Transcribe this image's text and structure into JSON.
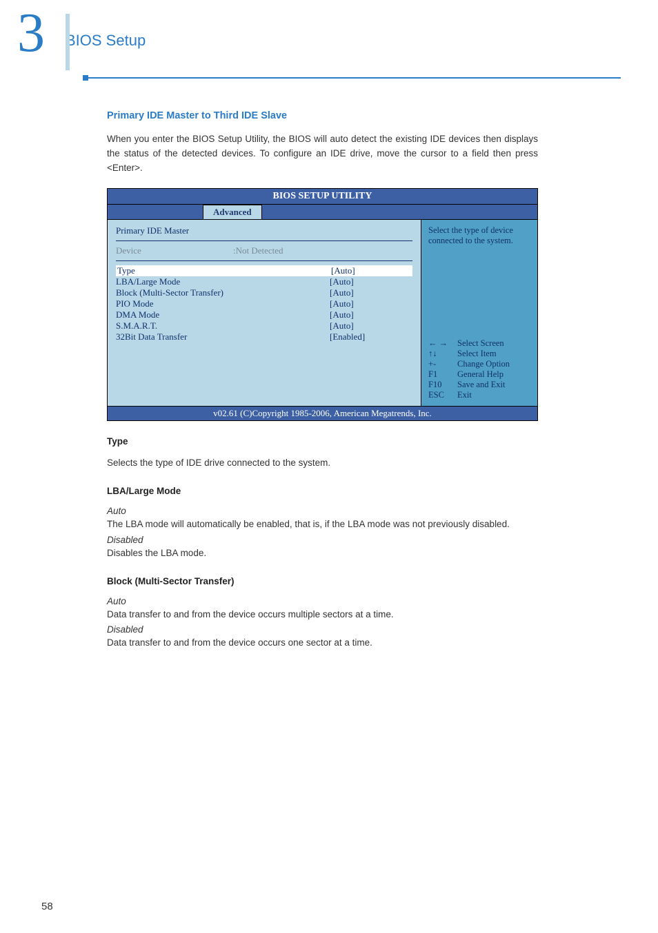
{
  "header": {
    "chapter_number": "3",
    "chapter_title": "BIOS Setup"
  },
  "section_title": "Primary IDE Master to Third IDE Slave",
  "intro_paragraph": "When you enter the BIOS Setup Utility, the BIOS will auto detect the existing IDE devices then displays the status of the detected devices. To configure an IDE drive, move the cursor to a field then press <Enter>.",
  "bios": {
    "title": "BIOS SETUP UTILITY",
    "tab": "Advanced",
    "screen_title": "Primary IDE Master",
    "device_label": "Device",
    "device_value": ":Not Detected",
    "items": [
      {
        "label": "Type",
        "value": "[Auto]",
        "highlight": true
      },
      {
        "label": "LBA/Large Mode",
        "value": "[Auto]"
      },
      {
        "label": "Block (Multi-Sector Transfer)",
        "value": "[Auto]"
      },
      {
        "label": "PIO Mode",
        "value": "[Auto]"
      },
      {
        "label": "DMA Mode",
        "value": "[Auto]"
      },
      {
        "label": "S.M.A.R.T.",
        "value": "[Auto]"
      },
      {
        "label": "32Bit Data Transfer",
        "value": "[Enabled]"
      }
    ],
    "help_text": "Select the type of device connected to the system.",
    "keys": [
      {
        "k": "← →",
        "d": "Select Screen"
      },
      {
        "k": "↑↓",
        "d": "Select Item"
      },
      {
        "k": "+-",
        "d": "Change Option"
      },
      {
        "k": "F1",
        "d": "General Help"
      },
      {
        "k": "F10",
        "d": "Save and Exit"
      },
      {
        "k": "ESC",
        "d": "Exit"
      }
    ],
    "footer": "v02.61 (C)Copyright 1985-2006, American Megatrends, Inc."
  },
  "subsections": {
    "type_heading": "Type",
    "type_text": "Selects the type of IDE drive connected to the system.",
    "lba_heading": "LBA/Large Mode",
    "lba_auto_label": "Auto",
    "lba_auto_text": "The LBA mode will automatically be enabled, that is, if the LBA mode was not previously disabled.",
    "lba_disabled_label": "Disabled",
    "lba_disabled_text": "Disables the LBA mode.",
    "block_heading": "Block (Multi-Sector Transfer)",
    "block_auto_label": "Auto",
    "block_auto_text": "Data transfer to and from the device occurs multiple sectors at a time.",
    "block_disabled_label": "Disabled",
    "block_disabled_text": "Data transfer to and from the device occurs one sector at a time."
  },
  "page_number": "58"
}
